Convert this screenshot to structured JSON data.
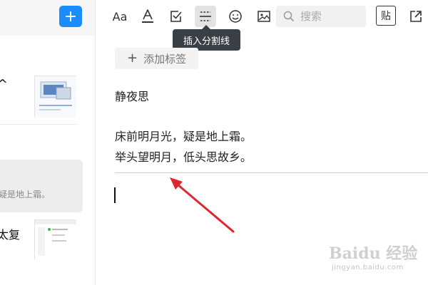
{
  "toolbar": {
    "font_label": "Aa",
    "color_label": "A",
    "hr_tooltip": "插入分割线",
    "search_placeholder": "搜索",
    "paste_label": "贴"
  },
  "editor": {
    "add_tag_label": "添加标签",
    "title": "静夜思",
    "lines": [
      "床前明月光，疑是地上霜。",
      "举头望明月，低头思故乡。"
    ]
  },
  "note_list": {
    "item1_title_fragment": "^",
    "item2_snippet": "疑是地上霜。",
    "item3_title_fragment": "太复"
  },
  "watermark": {
    "main": "Baidu 经验",
    "sub": "jingyan.baidu.com"
  },
  "colors": {
    "accent": "#1a8cfb",
    "tooltip_bg": "#3a3f45",
    "arrow": "#e0262b"
  }
}
